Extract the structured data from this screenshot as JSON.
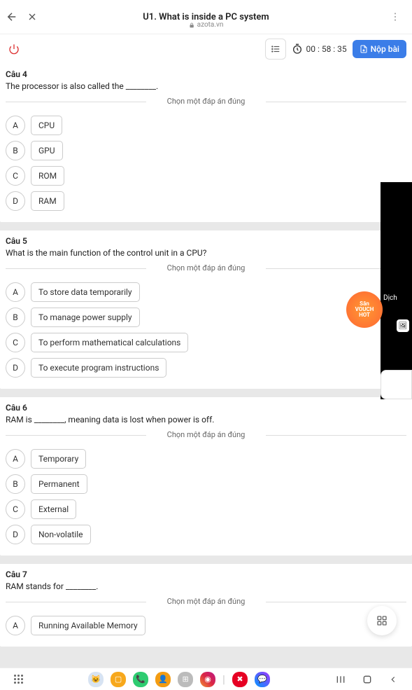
{
  "header": {
    "title": "U1. What is inside a PC system",
    "url": "azota.vn"
  },
  "timer": "00 : 58 : 35",
  "submit_label": "Nộp bài",
  "instruction": "Chọn một đáp án đúng",
  "questions": [
    {
      "label": "Câu 4",
      "text": "The processor is also called the ________.",
      "options": [
        {
          "letter": "A",
          "text": "CPU"
        },
        {
          "letter": "B",
          "text": "GPU"
        },
        {
          "letter": "C",
          "text": "ROM"
        },
        {
          "letter": "D",
          "text": "RAM"
        }
      ]
    },
    {
      "label": "Câu 5",
      "text": "What is the main function of the control unit in a CPU?",
      "options": [
        {
          "letter": "A",
          "text": "To store data temporarily"
        },
        {
          "letter": "B",
          "text": "To manage power supply"
        },
        {
          "letter": "C",
          "text": "To perform mathematical calculations"
        },
        {
          "letter": "D",
          "text": "To execute program instructions"
        }
      ]
    },
    {
      "label": "Câu 6",
      "text": "RAM is ________, meaning data is lost when power is off.",
      "options": [
        {
          "letter": "A",
          "text": "Temporary"
        },
        {
          "letter": "B",
          "text": "Permanent"
        },
        {
          "letter": "C",
          "text": "External"
        },
        {
          "letter": "D",
          "text": "Non-volatile"
        }
      ]
    },
    {
      "label": "Câu 7",
      "text": "RAM stands for ________.",
      "options": [
        {
          "letter": "A",
          "text": "Running Available Memory"
        }
      ]
    }
  ],
  "overlay": {
    "translate": "Dịch",
    "voucher_line1": "Săn",
    "voucher_line2": "VOUCH",
    "voucher_line3": "HOT"
  }
}
